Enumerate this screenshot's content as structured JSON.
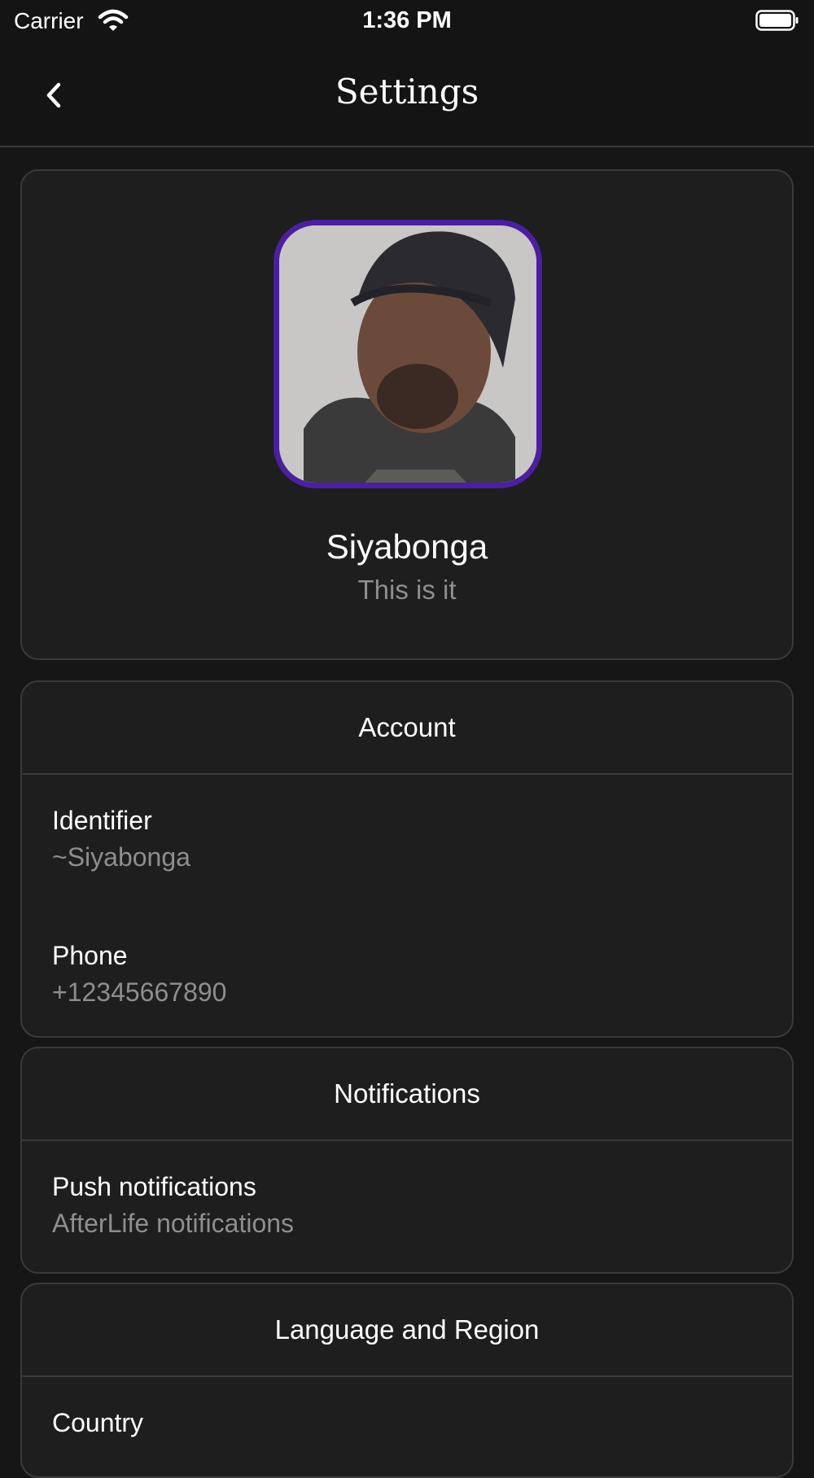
{
  "status_bar": {
    "carrier": "Carrier",
    "time": "1:36 PM"
  },
  "nav": {
    "title": "Settings",
    "back_icon": "chevron-left-icon"
  },
  "profile": {
    "name": "Siyabonga",
    "status": "This is it",
    "avatar_border_color": "#4b1fa0"
  },
  "sections": {
    "account": {
      "title": "Account",
      "rows": [
        {
          "label": "Identifier",
          "value": "~Siyabonga"
        },
        {
          "label": "Phone",
          "value": "+12345667890"
        }
      ]
    },
    "notifications": {
      "title": "Notifications",
      "rows": [
        {
          "label": "Push notifications",
          "value": "AfterLife notifications"
        }
      ]
    },
    "language": {
      "title": "Language and Region",
      "rows": [
        {
          "label": "Country"
        }
      ]
    }
  },
  "colors": {
    "background": "#161616",
    "card": "#1e1e1e",
    "accent": "#4b1fa0",
    "secondary_text": "#8e8e8e"
  }
}
